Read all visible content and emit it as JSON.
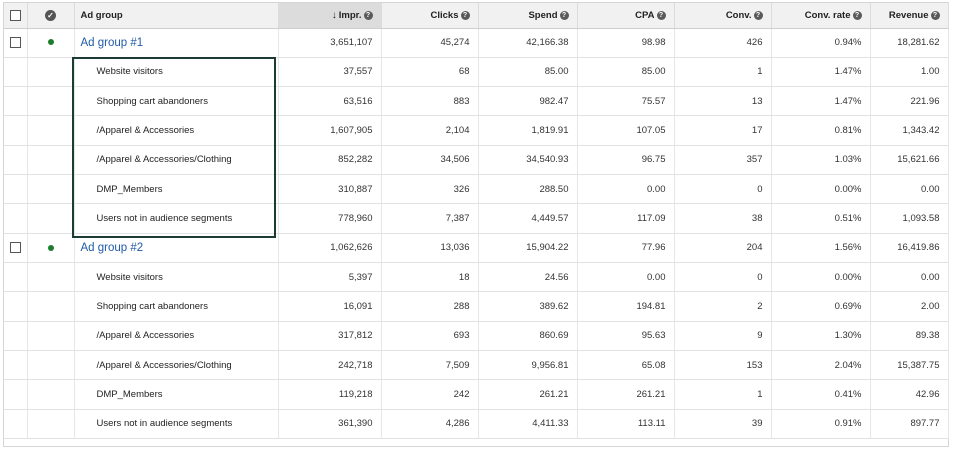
{
  "header": {
    "ad_group": "Ad group",
    "impr": "Impr.",
    "clicks": "Clicks",
    "spend": "Spend",
    "cpa": "CPA",
    "conv": "Conv.",
    "conv_rate": "Conv. rate",
    "revenue": "Revenue"
  },
  "groups": [
    {
      "name": "Ad group #1",
      "impr": "3,651,107",
      "clicks": "45,274",
      "spend": "42,166.38",
      "cpa": "98.98",
      "conv": "426",
      "conv_rate": "0.94%",
      "revenue": "18,281.62",
      "rows": [
        {
          "label": "Website visitors",
          "impr": "37,557",
          "clicks": "68",
          "spend": "85.00",
          "cpa": "85.00",
          "conv": "1",
          "conv_rate": "1.47%",
          "revenue": "1.00"
        },
        {
          "label": "Shopping cart abandoners",
          "impr": "63,516",
          "clicks": "883",
          "spend": "982.47",
          "cpa": "75.57",
          "conv": "13",
          "conv_rate": "1.47%",
          "revenue": "221.96"
        },
        {
          "label": "/Apparel & Accessories",
          "impr": "1,607,905",
          "clicks": "2,104",
          "spend": "1,819.91",
          "cpa": "107.05",
          "conv": "17",
          "conv_rate": "0.81%",
          "revenue": "1,343.42"
        },
        {
          "label": "/Apparel & Accessories/Clothing",
          "impr": "852,282",
          "clicks": "34,506",
          "spend": "34,540.93",
          "cpa": "96.75",
          "conv": "357",
          "conv_rate": "1.03%",
          "revenue": "15,621.66"
        },
        {
          "label": "DMP_Members",
          "impr": "310,887",
          "clicks": "326",
          "spend": "288.50",
          "cpa": "0.00",
          "conv": "0",
          "conv_rate": "0.00%",
          "revenue": "0.00"
        },
        {
          "label": "Users not in audience segments",
          "impr": "778,960",
          "clicks": "7,387",
          "spend": "4,449.57",
          "cpa": "117.09",
          "conv": "38",
          "conv_rate": "0.51%",
          "revenue": "1,093.58"
        }
      ]
    },
    {
      "name": "Ad group #2",
      "impr": "1,062,626",
      "clicks": "13,036",
      "spend": "15,904.22",
      "cpa": "77.96",
      "conv": "204",
      "conv_rate": "1.56%",
      "revenue": "16,419.86",
      "rows": [
        {
          "label": "Website visitors",
          "impr": "5,397",
          "clicks": "18",
          "spend": "24.56",
          "cpa": "0.00",
          "conv": "0",
          "conv_rate": "0.00%",
          "revenue": "0.00"
        },
        {
          "label": "Shopping cart abandoners",
          "impr": "16,091",
          "clicks": "288",
          "spend": "389.62",
          "cpa": "194.81",
          "conv": "2",
          "conv_rate": "0.69%",
          "revenue": "2.00"
        },
        {
          "label": "/Apparel & Accessories",
          "impr": "317,812",
          "clicks": "693",
          "spend": "860.69",
          "cpa": "95.63",
          "conv": "9",
          "conv_rate": "1.30%",
          "revenue": "89.38"
        },
        {
          "label": "/Apparel & Accessories/Clothing",
          "impr": "242,718",
          "clicks": "7,509",
          "spend": "9,956.81",
          "cpa": "65.08",
          "conv": "153",
          "conv_rate": "2.04%",
          "revenue": "15,387.75"
        },
        {
          "label": "DMP_Members",
          "impr": "119,218",
          "clicks": "242",
          "spend": "261.21",
          "cpa": "261.21",
          "conv": "1",
          "conv_rate": "0.41%",
          "revenue": "42.96"
        },
        {
          "label": "Users not in audience segments",
          "impr": "361,390",
          "clicks": "4,286",
          "spend": "4,411.33",
          "cpa": "113.11",
          "conv": "39",
          "conv_rate": "0.91%",
          "revenue": "897.77"
        }
      ]
    }
  ],
  "colors": {
    "link": "#1f5aa6",
    "status_dot": "#1e7d2d",
    "highlight_border": "#1d3b35",
    "sorted_header": "#dcdcdc"
  },
  "icons": {
    "sort": "arrow-down-icon",
    "help": "question-icon",
    "status": "check-circle-icon"
  }
}
